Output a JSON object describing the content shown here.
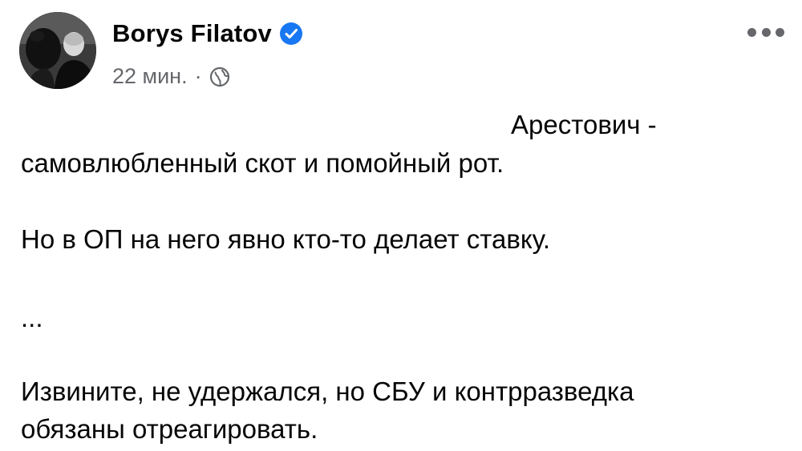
{
  "post": {
    "author": "Borys Filatov",
    "timestamp": "22 мин.",
    "separator": "·",
    "icons": {
      "avatar": "profile-photo",
      "verified": "verified-badge-icon",
      "audience": "globe-icon",
      "more": "more-options-icon"
    },
    "colors": {
      "verified": "#1877f2",
      "meta": "#65676b",
      "text": "#050505"
    },
    "lines": [
      "Арестович -",
      "самовлюбленный скот и помойный рот.",
      "Но в ОП на него явно кто-то делает ставку.",
      "...",
      "Извините, не удержался, но СБУ и контрразведка",
      "обязаны отреагировать."
    ]
  }
}
